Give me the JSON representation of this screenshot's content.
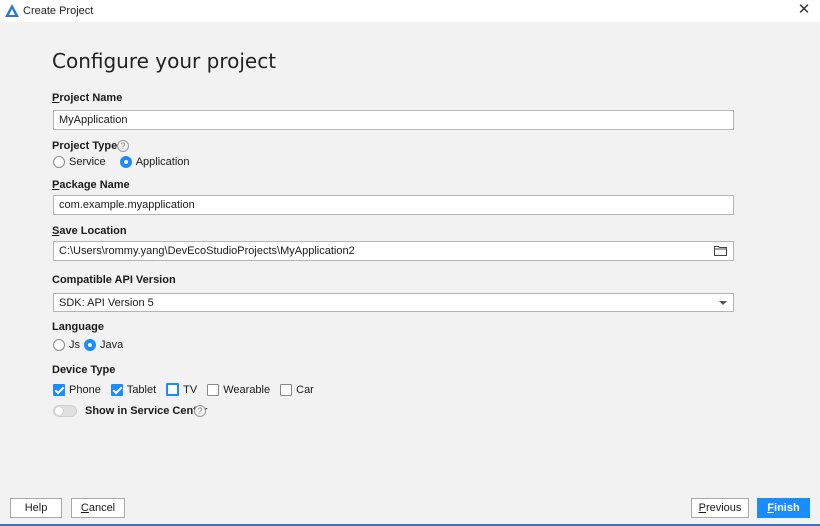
{
  "window": {
    "title": "Create Project",
    "close_glyph": "✕"
  },
  "heading": "Configure your project",
  "project_name": {
    "label_u": "P",
    "label_rest": "roject Name",
    "value": "MyApplication"
  },
  "project_type": {
    "label": "Project Type",
    "help_glyph": "?",
    "options": [
      {
        "label": "Service",
        "checked": false
      },
      {
        "label": "Application",
        "checked": true
      }
    ]
  },
  "package_name": {
    "label_u": "P",
    "label_rest": "ackage Name",
    "value": "com.example.myapplication"
  },
  "save_location": {
    "label_u": "S",
    "label_rest": "ave Location",
    "value": "C:\\Users\\rommy.yang\\DevEcoStudioProjects\\MyApplication2"
  },
  "api_version": {
    "label": "Compatible API Version",
    "selected": "SDK: API Version 5"
  },
  "language": {
    "label": "Language",
    "options": [
      {
        "label": "Js",
        "checked": false
      },
      {
        "label": "Java",
        "checked": true
      }
    ]
  },
  "device_type": {
    "label": "Device Type",
    "options": [
      {
        "label": "Phone",
        "checked": true
      },
      {
        "label": "Tablet",
        "checked": true
      },
      {
        "label": "TV",
        "checked": false
      },
      {
        "label": "Wearable",
        "checked": false
      },
      {
        "label": "Car",
        "checked": false
      }
    ]
  },
  "service_center": {
    "label": "Show in Service Center",
    "enabled": false,
    "help_glyph": "?"
  },
  "buttons": {
    "help": "Help",
    "cancel_u": "C",
    "cancel_rest": "ancel",
    "previous_u": "P",
    "previous_rest": "revious",
    "finish_u": "F",
    "finish_rest": "inish"
  },
  "colors": {
    "accent": "#1a8cff",
    "background": "#f2f2f2"
  },
  "icons": {
    "app": "harmony-logo-icon",
    "folder": "folder-icon",
    "dropdown": "chevron-down-icon"
  }
}
